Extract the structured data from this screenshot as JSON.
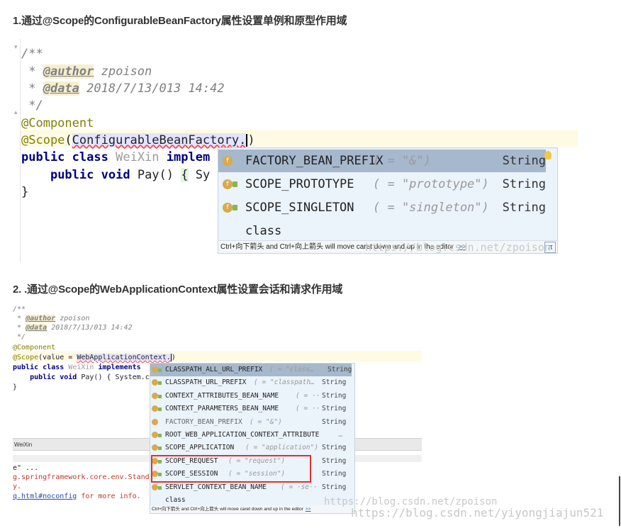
{
  "headings": {
    "first": "1.通过@Scope的ConfigurableBeanFactory属性设置单例和原型作用域",
    "second": "2. .通过@Scope的WebApplicationContext属性设置会话和请求作用域"
  },
  "editor1": {
    "comment_open": "/**",
    "author_tag": "@author",
    "author_value": "zpoison",
    "data_tag": "@data",
    "data_value": "2018/7/13/013 14:42",
    "comment_close": "*/",
    "component_annotation": "@Component",
    "scope_annotation": "@Scope",
    "scope_arg": "ConfigurableBeanFactory.",
    "class_kw1": "public",
    "class_kw2": "class",
    "class_name": "WeiXin",
    "implements_kw": "implem",
    "method_kw1": "public",
    "method_kw2": "void",
    "method_sig": "Pay()",
    "method_brace": "{",
    "method_tail": "Sy",
    "closing_brace": "}"
  },
  "popup1": {
    "items": [
      {
        "name": "FACTORY_BEAN_PREFIX",
        "hint": "( = \"&\")",
        "type": "String"
      },
      {
        "name": "SCOPE_PROTOTYPE",
        "hint": "( = \"prototype\")",
        "type": "String"
      },
      {
        "name": "SCOPE_SINGLETON",
        "hint": "( = \"singleton\")",
        "type": "String"
      },
      {
        "name": "class",
        "hint": "",
        "type": ""
      }
    ],
    "footer_text": "Ctrl+向下箭头 and Ctrl+向上箭头 will move caret down and up in the editor",
    "footer_link": ">>",
    "pi_glyph": "π"
  },
  "watermark1": "https://blog.csdn.net/zpoison",
  "editor2": {
    "comment_open": "/**",
    "author_line_tag": "@author",
    "author_value": "zpoison",
    "data_tag": "@data",
    "data_value": "2018/7/13/013 14:42",
    "comment_close": "*/",
    "component_annotation": "@Component",
    "scope_annotation": "@Scope",
    "scope_arg_prefix": "(value = ",
    "scope_arg": "WebApplicationContext.",
    "class_kw1": "public",
    "class_kw2": "class",
    "class_name": "WeiXin",
    "implements_kw": "implements",
    "method_kw1": "public",
    "method_kw2": "void",
    "method_sig": "Pay()",
    "method_body": "{ System.c",
    "closing_brace": "}",
    "tab_label": "WeiXin",
    "console_line1": "e\" ...",
    "console_line2": "g.springframework.core.env.Standar",
    "console_line3": "y.",
    "console_link": "q.html#noconfig",
    "console_line4_tail": " for more info."
  },
  "popup2": {
    "items": [
      {
        "name": "CLASSPATH_ALL_URL_PREFIX",
        "hint": "( = \"class…",
        "type": "String"
      },
      {
        "name": "CLASSPATH_URL_PREFIX",
        "hint": "( = \"classpath…",
        "type": "String"
      },
      {
        "name": "CONTEXT_ATTRIBUTES_BEAN_NAME",
        "hint": "( = ··",
        "type": "String"
      },
      {
        "name": "CONTEXT_PARAMETERS_BEAN_NAME",
        "hint": "( = ··",
        "type": "String"
      },
      {
        "name": "FACTORY_BEAN_PREFIX",
        "hint": "( = \"&\")",
        "type": "String"
      },
      {
        "name": "ROOT_WEB_APPLICATION_CONTEXT_ATTRIBUTE",
        "hint": "…",
        "type": ""
      },
      {
        "name": "SCOPE_APPLICATION",
        "hint": "( = \"application\")",
        "type": "String"
      },
      {
        "name": "SCOPE_REQUEST",
        "hint": "( = \"request\")",
        "type": "String"
      },
      {
        "name": "SCOPE_SESSION",
        "hint": "( = \"session\")",
        "type": "String"
      },
      {
        "name": "SERVLET_CONTEXT_BEAN_NAME",
        "hint": "( = ·se··",
        "type": "String"
      },
      {
        "name": "class",
        "hint": "",
        "type": ""
      }
    ],
    "footer_text": "Ctrl+向下箭头 and Ctrl+向上箭头 will move caret down and up in the editor",
    "footer_link": ">>"
  },
  "watermark2a": "https://blog.csdn.net/zpoison",
  "watermark2b": "https://blog.csdn.net/yiyongjiajun521"
}
